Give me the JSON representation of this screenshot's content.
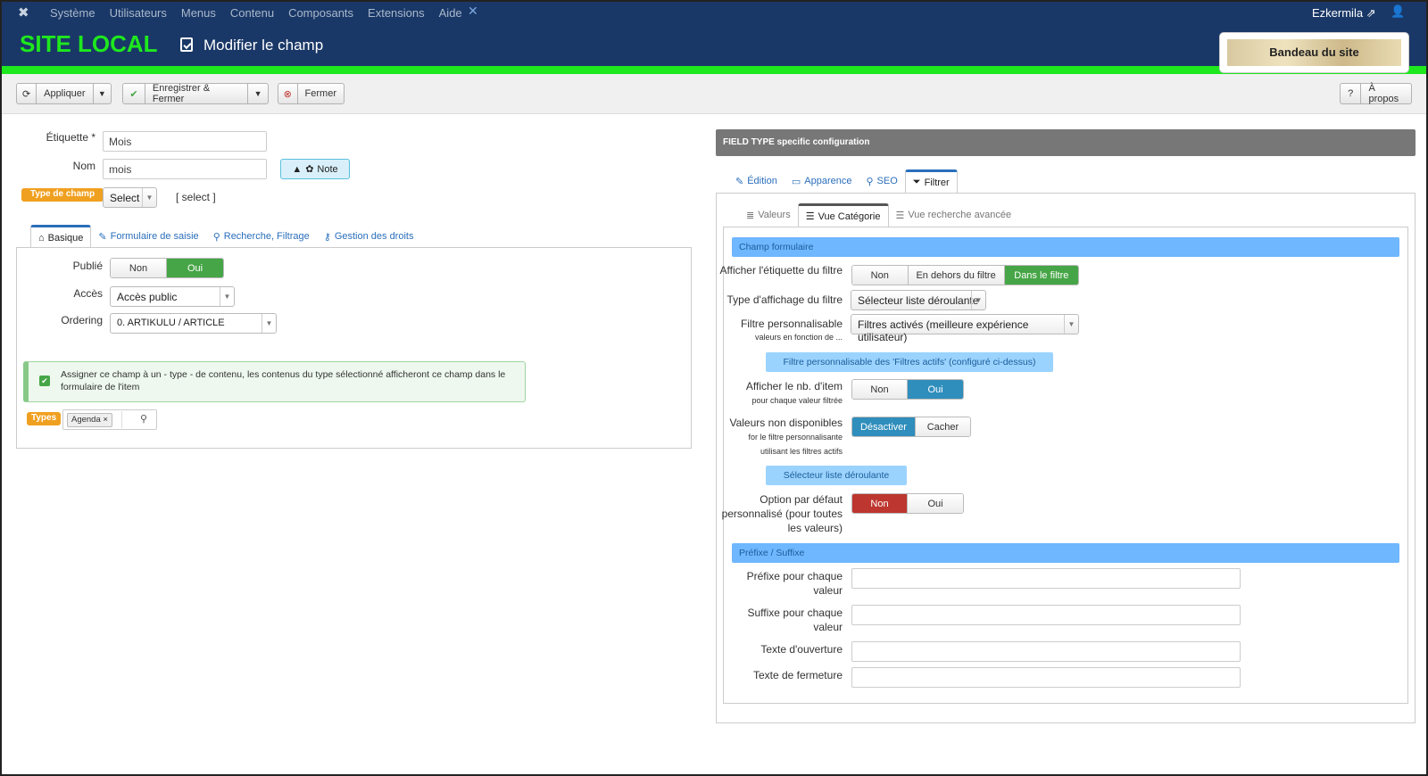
{
  "topnav": {
    "menu": [
      "Système",
      "Utilisateurs",
      "Menus",
      "Contenu",
      "Composants",
      "Extensions",
      "Aide"
    ],
    "user": "Ezkermila"
  },
  "header": {
    "site_title": "SITE LOCAL",
    "page_title": "Modifier le champ",
    "banner": "Bandeau du site"
  },
  "toolbar": {
    "apply": "Appliquer",
    "save_close": "Enregistrer & Fermer",
    "close": "Fermer",
    "about": "À propos"
  },
  "form": {
    "label_label": "Étiquette *",
    "label_value": "Mois",
    "name_label": "Nom",
    "name_value": "mois",
    "note": "Note",
    "type_badge": "Type de champ",
    "type_select": "Select",
    "type_hint": "[ select ]"
  },
  "left_tabs": [
    "Basique",
    "Formulaire de saisie",
    "Recherche, Filtrage",
    "Gestion des droits"
  ],
  "basic": {
    "published_label": "Publié",
    "published_options": [
      "Non",
      "Oui"
    ],
    "access_label": "Accès",
    "access_value": "Accès public",
    "ordering_label": "Ordering",
    "ordering_value": "0. ARTIKULU / ARTICLE",
    "alert": "Assigner ce champ à un - type - de contenu, les contenus du type sélectionné afficheront ce champ dans le formulaire de l'item",
    "types_badge": "Types",
    "types_tag": "Agenda"
  },
  "right": {
    "header": "FIELD TYPE specific configuration",
    "tabs": [
      "Édition",
      "Apparence",
      "SEO",
      "Filtrer"
    ],
    "subtabs": [
      "Valeurs",
      "Vue Catégorie",
      "Vue recherche avancée"
    ],
    "section1": "Champ formulaire",
    "show_label": "Afficher l'étiquette du filtre",
    "show_options": [
      "Non",
      "En dehors du filtre",
      "Dans le filtre"
    ],
    "display_type_label": "Type d'affichage du filtre",
    "display_type_value": "Sélecteur liste déroulante",
    "custom_label": "Filtre personnalisable",
    "custom_sub": "valeurs en fonction de ...",
    "custom_value": "Filtres activés (meilleure expérience utilisateur)",
    "custom_pill": "Filtre personnalisable des 'Filtres actifs' (configuré ci-dessus)",
    "count_label": "Afficher le nb. d'item",
    "count_sub": "pour chaque valeur filtrée",
    "count_options": [
      "Non",
      "Oui"
    ],
    "unavail_label": "Valeurs non disponibles",
    "unavail_sub1": "for le filtre personnalisante",
    "unavail_sub2": "utilisant les filtres actifs",
    "unavail_options": [
      "Désactiver",
      "Cacher"
    ],
    "select_pill": "Sélecteur liste déroulante",
    "default_label1": "Option par défaut",
    "default_label2": "personnalisé (pour toutes",
    "default_label3": "les valeurs)",
    "default_options": [
      "Non",
      "Oui"
    ],
    "section2": "Préfixe / Suffixe",
    "prefix_label1": "Préfixe pour chaque",
    "prefix_label2": "valeur",
    "suffix_label1": "Suffixe pour chaque",
    "suffix_label2": "valeur",
    "open_label": "Texte d'ouverture",
    "close_label": "Texte de fermeture"
  },
  "colors": {
    "navy": "#1a3867",
    "green": "#1ee81e",
    "blue": "#2a6ebb"
  }
}
